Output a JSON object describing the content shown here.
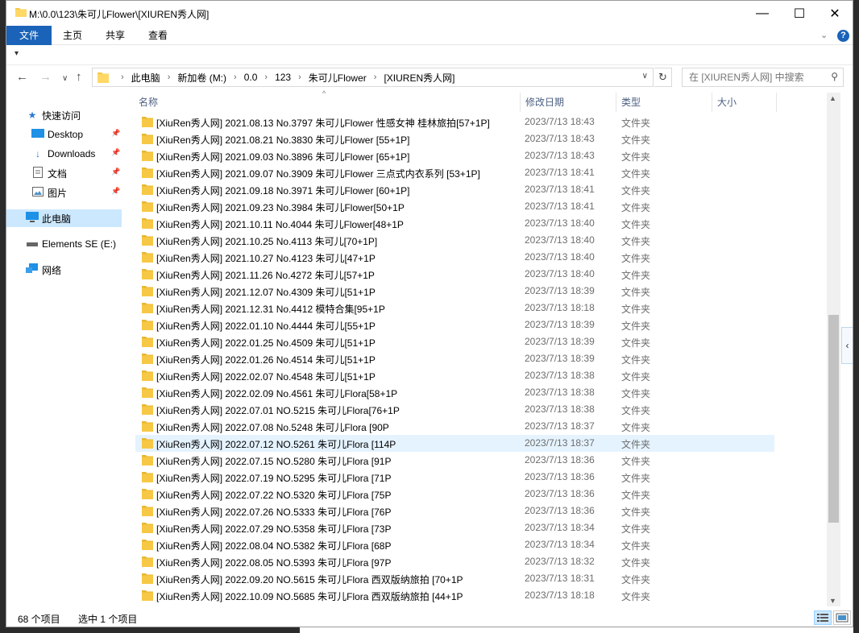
{
  "window": {
    "title": "M:\\0.0\\123\\朱可儿Flower\\[XIUREN秀人网]",
    "minimize": "—",
    "maximize": "☐",
    "close": "✕"
  },
  "ribbon": {
    "tabs": [
      "文件",
      "主页",
      "共享",
      "查看"
    ],
    "help": "?"
  },
  "address": {
    "crumbs": [
      "此电脑",
      "新加卷 (M:)",
      "0.0",
      "123",
      "朱可儿Flower",
      "[XIUREN秀人网]"
    ],
    "search_placeholder": "在 [XIUREN秀人网] 中搜索"
  },
  "nav": {
    "quick_access": "快速访问",
    "desktop": "Desktop",
    "downloads": "Downloads",
    "documents": "文档",
    "pictures": "图片",
    "this_pc": "此电脑",
    "drive": "Elements SE (E:)",
    "network": "网络"
  },
  "columns": {
    "name": "名称",
    "date": "修改日期",
    "type": "类型",
    "size": "大小"
  },
  "files": [
    {
      "name": "[XiuRen秀人网] 2021.08.13 No.3797 朱可儿Flower 性感女神 桂林旅拍[57+1P]",
      "date": "2023/7/13 18:43",
      "type": "文件夹"
    },
    {
      "name": "[XiuRen秀人网] 2021.08.21 No.3830 朱可儿Flower [55+1P]",
      "date": "2023/7/13 18:43",
      "type": "文件夹"
    },
    {
      "name": "[XiuRen秀人网] 2021.09.03 No.3896 朱可儿Flower [65+1P]",
      "date": "2023/7/13 18:43",
      "type": "文件夹"
    },
    {
      "name": "[XiuRen秀人网] 2021.09.07 No.3909 朱可儿Flower 三点式内衣系列 [53+1P]",
      "date": "2023/7/13 18:41",
      "type": "文件夹"
    },
    {
      "name": "[XiuRen秀人网] 2021.09.18 No.3971 朱可儿Flower [60+1P]",
      "date": "2023/7/13 18:41",
      "type": "文件夹"
    },
    {
      "name": "[XiuRen秀人网] 2021.09.23 No.3984 朱可儿Flower[50+1P",
      "date": "2023/7/13 18:41",
      "type": "文件夹"
    },
    {
      "name": "[XiuRen秀人网] 2021.10.11 No.4044 朱可儿Flower[48+1P",
      "date": "2023/7/13 18:40",
      "type": "文件夹"
    },
    {
      "name": "[XiuRen秀人网] 2021.10.25 No.4113 朱可儿[70+1P]",
      "date": "2023/7/13 18:40",
      "type": "文件夹"
    },
    {
      "name": "[XiuRen秀人网] 2021.10.27 No.4123 朱可儿[47+1P",
      "date": "2023/7/13 18:40",
      "type": "文件夹"
    },
    {
      "name": "[XiuRen秀人网] 2021.11.26 No.4272 朱可儿[57+1P",
      "date": "2023/7/13 18:40",
      "type": "文件夹"
    },
    {
      "name": "[XiuRen秀人网] 2021.12.07 No.4309 朱可儿[51+1P",
      "date": "2023/7/13 18:39",
      "type": "文件夹"
    },
    {
      "name": "[XiuRen秀人网] 2021.12.31 No.4412 模特合集[95+1P",
      "date": "2023/7/13 18:18",
      "type": "文件夹"
    },
    {
      "name": "[XiuRen秀人网] 2022.01.10 No.4444 朱可儿[55+1P",
      "date": "2023/7/13 18:39",
      "type": "文件夹"
    },
    {
      "name": "[XiuRen秀人网] 2022.01.25 No.4509 朱可儿[51+1P",
      "date": "2023/7/13 18:39",
      "type": "文件夹"
    },
    {
      "name": "[XiuRen秀人网] 2022.01.26 No.4514 朱可儿[51+1P",
      "date": "2023/7/13 18:39",
      "type": "文件夹"
    },
    {
      "name": "[XiuRen秀人网] 2022.02.07 No.4548 朱可儿[51+1P",
      "date": "2023/7/13 18:38",
      "type": "文件夹"
    },
    {
      "name": "[XiuRen秀人网] 2022.02.09 No.4561 朱可儿Flora[58+1P",
      "date": "2023/7/13 18:38",
      "type": "文件夹"
    },
    {
      "name": "[XiuRen秀人网] 2022.07.01 NO.5215 朱可儿Flora[76+1P",
      "date": "2023/7/13 18:38",
      "type": "文件夹"
    },
    {
      "name": "[XiuRen秀人网] 2022.07.08 No.5248 朱可儿Flora [90P",
      "date": "2023/7/13 18:37",
      "type": "文件夹"
    },
    {
      "name": "[XiuRen秀人网] 2022.07.12 NO.5261 朱可儿Flora [114P",
      "date": "2023/7/13 18:37",
      "type": "文件夹"
    },
    {
      "name": "[XiuRen秀人网] 2022.07.15 NO.5280 朱可儿Flora [91P",
      "date": "2023/7/13 18:36",
      "type": "文件夹"
    },
    {
      "name": "[XiuRen秀人网] 2022.07.19 NO.5295 朱可儿Flora [71P",
      "date": "2023/7/13 18:36",
      "type": "文件夹"
    },
    {
      "name": "[XiuRen秀人网] 2022.07.22 NO.5320 朱可儿Flora [75P",
      "date": "2023/7/13 18:36",
      "type": "文件夹"
    },
    {
      "name": "[XiuRen秀人网] 2022.07.26 NO.5333 朱可儿Flora [76P",
      "date": "2023/7/13 18:36",
      "type": "文件夹"
    },
    {
      "name": "[XiuRen秀人网] 2022.07.29 NO.5358 朱可儿Flora [73P",
      "date": "2023/7/13 18:34",
      "type": "文件夹"
    },
    {
      "name": "[XiuRen秀人网] 2022.08.04 NO.5382 朱可儿Flora [68P",
      "date": "2023/7/13 18:34",
      "type": "文件夹"
    },
    {
      "name": "[XiuRen秀人网] 2022.08.05 NO.5393 朱可儿Flora [97P",
      "date": "2023/7/13 18:32",
      "type": "文件夹"
    },
    {
      "name": "[XiuRen秀人网] 2022.09.20 NO.5615 朱可儿Flora 西双版纳旅拍 [70+1P",
      "date": "2023/7/13 18:31",
      "type": "文件夹"
    },
    {
      "name": "[XiuRen秀人网] 2022.10.09 NO.5685 朱可儿Flora 西双版纳旅拍 [44+1P",
      "date": "2023/7/13 18:18",
      "type": "文件夹"
    }
  ],
  "selected_index": 19,
  "status": {
    "count": "68 个项目",
    "selection": "选中 1 个项目"
  },
  "colors": {
    "accent": "#1a63b8",
    "selection": "#e5f3ff",
    "folder": "#f7c845"
  },
  "icons": {
    "folder": "folder-icon",
    "back": "arrow-left-icon",
    "forward": "arrow-right-icon",
    "up": "arrow-up-icon",
    "refresh": "refresh-icon",
    "search": "search-icon"
  }
}
